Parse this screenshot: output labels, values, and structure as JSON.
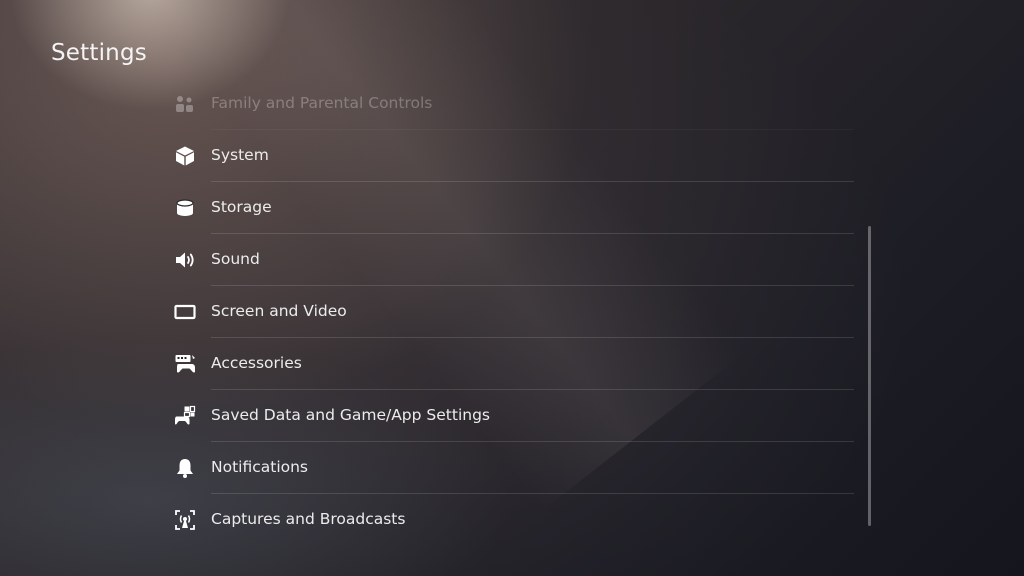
{
  "header": {
    "title": "Settings"
  },
  "menu": {
    "items": [
      {
        "label": "Family and Parental Controls",
        "icon": "family-icon"
      },
      {
        "label": "System",
        "icon": "cube-icon"
      },
      {
        "label": "Storage",
        "icon": "storage-icon"
      },
      {
        "label": "Sound",
        "icon": "speaker-icon"
      },
      {
        "label": "Screen and Video",
        "icon": "screen-icon"
      },
      {
        "label": "Accessories",
        "icon": "accessories-icon"
      },
      {
        "label": "Saved Data and Game/App Settings",
        "icon": "saved-data-icon"
      },
      {
        "label": "Notifications",
        "icon": "bell-icon"
      },
      {
        "label": "Captures and Broadcasts",
        "icon": "captures-icon"
      }
    ]
  }
}
